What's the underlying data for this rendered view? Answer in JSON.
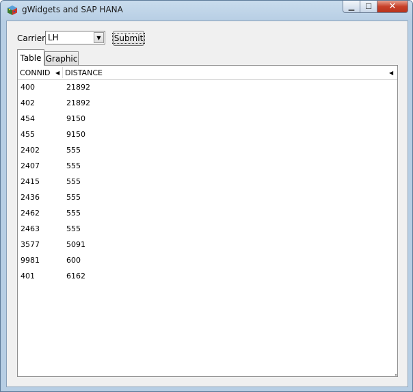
{
  "window": {
    "title": "gWidgets and SAP HANA",
    "icon": "r-cube-icon",
    "min_glyph": "▁",
    "max_glyph": "☐",
    "close_glyph": "✕"
  },
  "form": {
    "carrier_label": "Carrier",
    "carrier_value": "LH",
    "submit_label": "Submit"
  },
  "tabs": [
    {
      "label": "Table",
      "active": true
    },
    {
      "label": "Graphic",
      "active": false
    }
  ],
  "table": {
    "columns": [
      "CONNID",
      "DISTANCE"
    ],
    "sort_glyph": "◀",
    "rows": [
      [
        "400",
        "21892"
      ],
      [
        "402",
        "21892"
      ],
      [
        "454",
        "9150"
      ],
      [
        "455",
        "9150"
      ],
      [
        "2402",
        "555"
      ],
      [
        "2407",
        "555"
      ],
      [
        "2415",
        "555"
      ],
      [
        "2436",
        "555"
      ],
      [
        "2462",
        "555"
      ],
      [
        "2463",
        "555"
      ],
      [
        "3577",
        "5091"
      ],
      [
        "9981",
        "600"
      ],
      [
        "401",
        "6162"
      ]
    ]
  }
}
